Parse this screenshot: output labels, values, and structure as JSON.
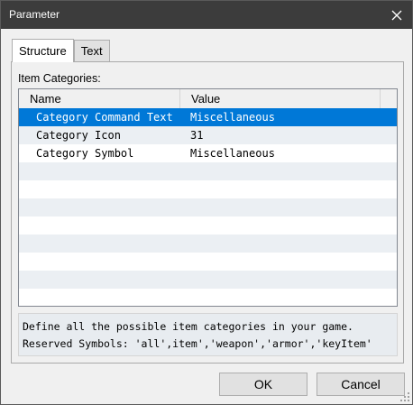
{
  "window": {
    "title": "Parameter"
  },
  "tabs": [
    {
      "label": "Structure",
      "active": true
    },
    {
      "label": "Text",
      "active": false
    }
  ],
  "group_label": "Item Categories:",
  "grid": {
    "columns": [
      "Name",
      "Value"
    ],
    "rows": [
      {
        "name": "Category Command Text",
        "value": "Miscellaneous",
        "selected": true
      },
      {
        "name": "Category Icon",
        "value": "31",
        "selected": false
      },
      {
        "name": "Category Symbol",
        "value": "Miscellaneous",
        "selected": false
      },
      {
        "name": "",
        "value": "",
        "selected": false
      },
      {
        "name": "",
        "value": "",
        "selected": false
      },
      {
        "name": "",
        "value": "",
        "selected": false
      },
      {
        "name": "",
        "value": "",
        "selected": false
      },
      {
        "name": "",
        "value": "",
        "selected": false
      },
      {
        "name": "",
        "value": "",
        "selected": false
      },
      {
        "name": "",
        "value": "",
        "selected": false
      },
      {
        "name": "",
        "value": "",
        "selected": false
      }
    ]
  },
  "description": {
    "line1": "Define all the possible item categories in your game.",
    "line2": "Reserved Symbols: 'all',item','weapon','armor','keyItem'"
  },
  "buttons": {
    "ok": "OK",
    "cancel": "Cancel"
  },
  "colors": {
    "titlebar": "#3c3c3c",
    "selection": "#0078d7",
    "row_alt": "#ebeff3"
  },
  "icons": {
    "close": "close-icon",
    "resize": "resize-grip-icon"
  }
}
